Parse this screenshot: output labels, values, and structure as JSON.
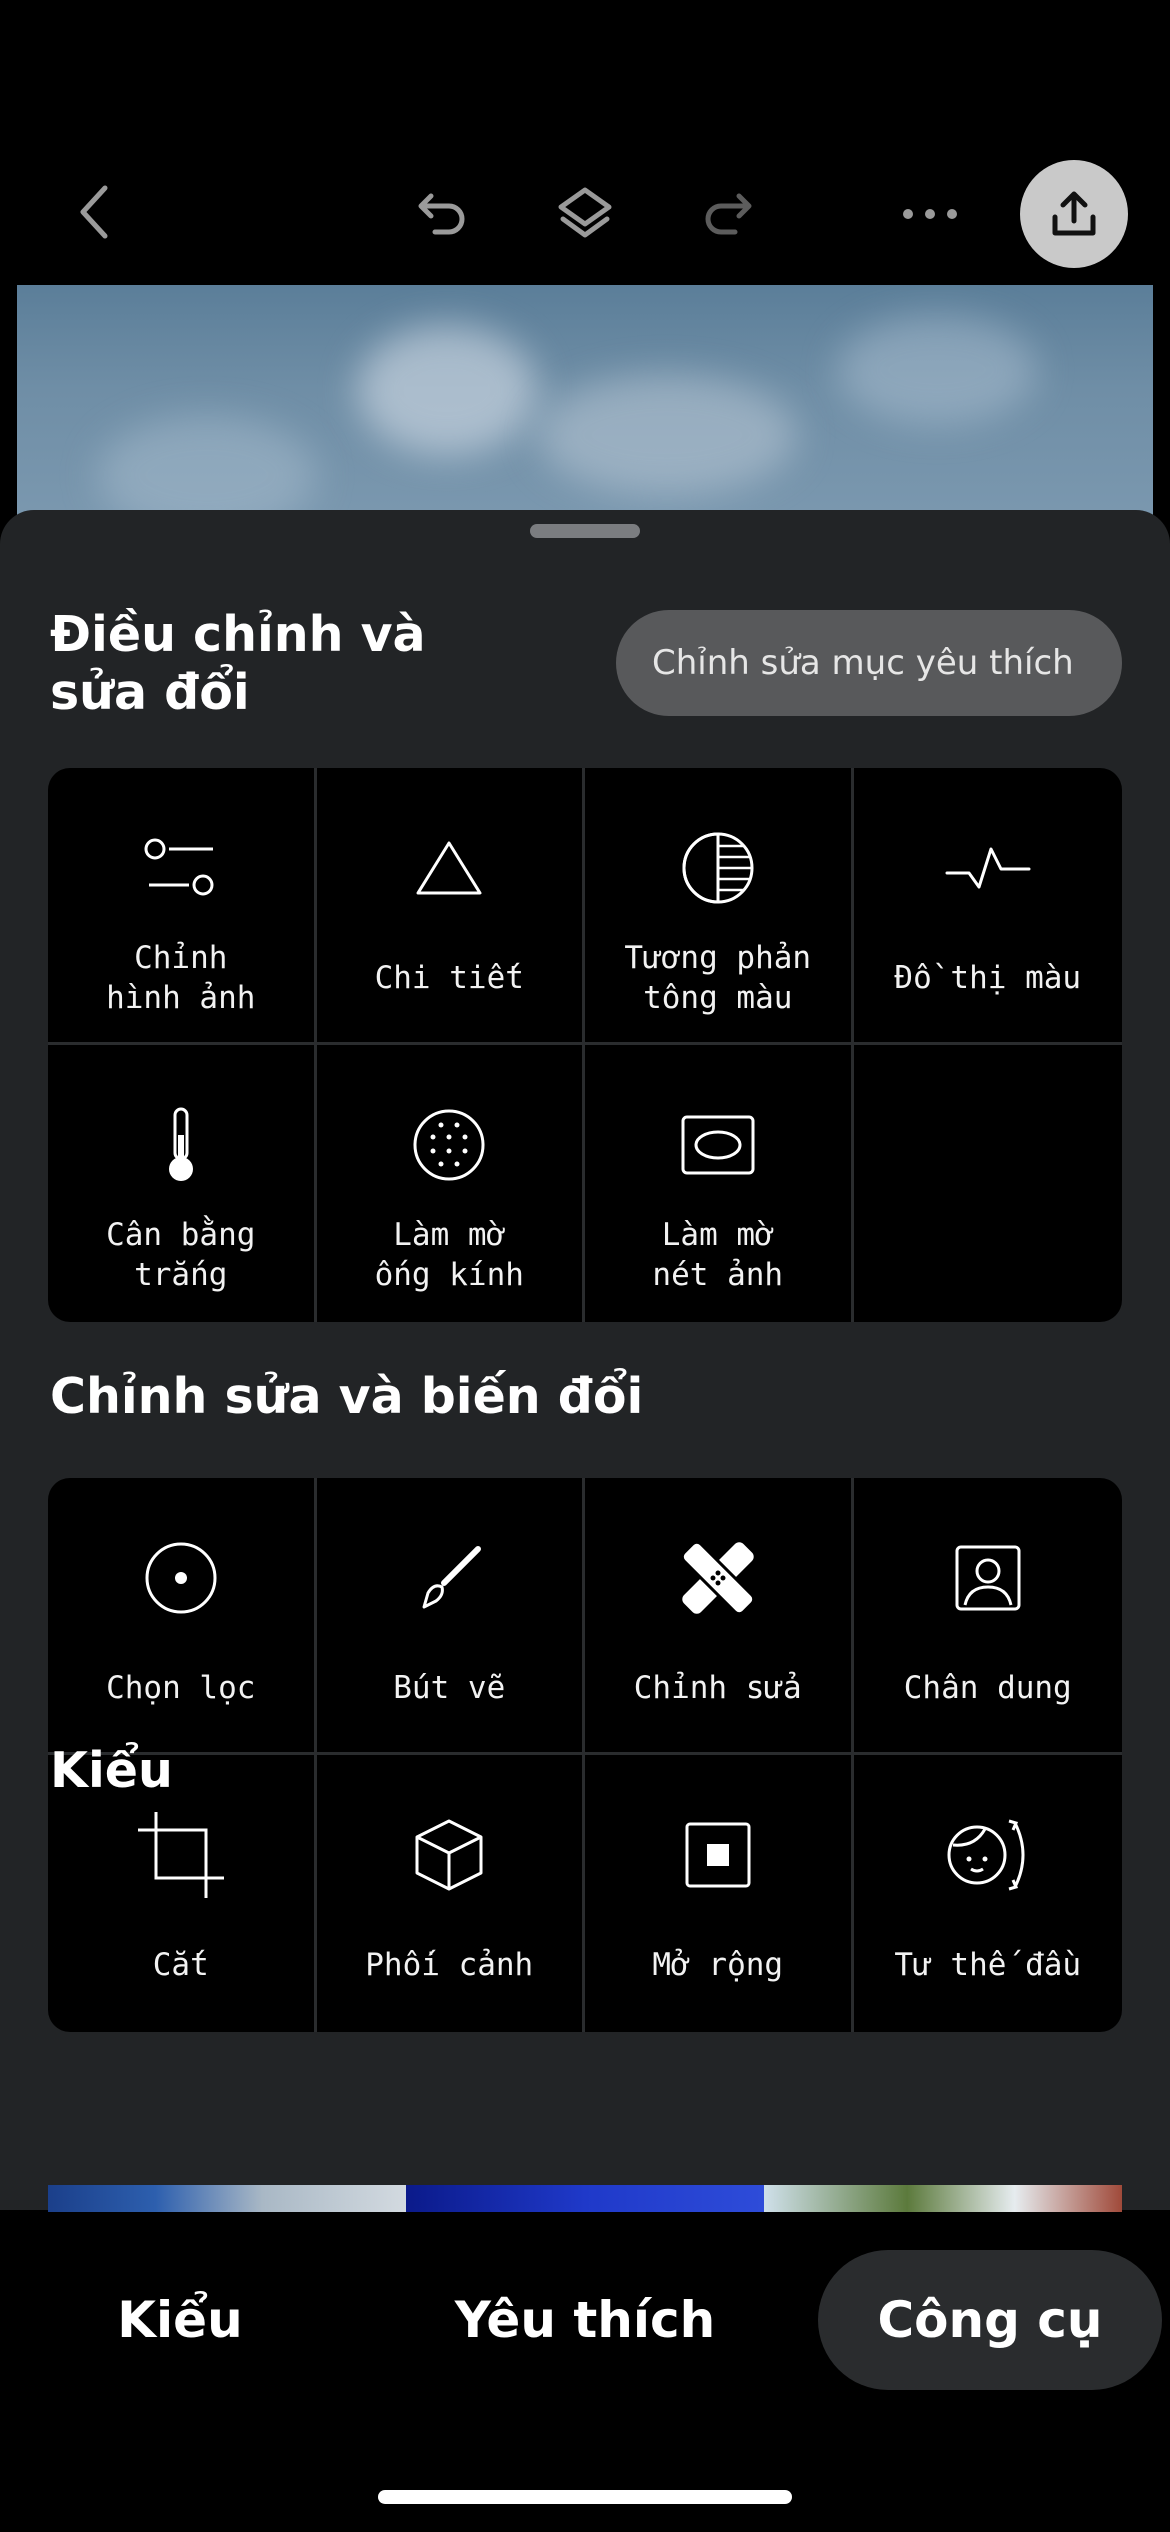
{
  "toolbar": {
    "icons": [
      "back-chevron-icon",
      "undo-icon",
      "layers-icon",
      "redo-icon",
      "more-icon",
      "share-icon"
    ]
  },
  "sheet": {
    "adjust": {
      "title_line1": "Điều chỉnh và",
      "title_line2": "sửa đổi",
      "search_placeholder": "Chỉnh sửa mục yêu thích",
      "tools": [
        {
          "label": "Chỉnh\nhình ảnh",
          "icon": "tune-icon"
        },
        {
          "label": "Chi tiết",
          "icon": "triangle-icon"
        },
        {
          "label": "Tương phản\ntông màu",
          "icon": "tonal-contrast-icon"
        },
        {
          "label": "Đồ thị màu",
          "icon": "curves-icon"
        },
        {
          "label": "Cân bằng\ntrắng",
          "icon": "thermometer-icon"
        },
        {
          "label": "Làm mờ\nống kính",
          "icon": "lens-blur-icon"
        },
        {
          "label": "Làm mờ\nnét ảnh",
          "icon": "vignette-icon"
        }
      ]
    },
    "edit": {
      "title": "Chỉnh sửa và biến đổi",
      "tools": [
        {
          "label": "Chọn lọc",
          "icon": "selective-icon"
        },
        {
          "label": "Bút vẽ",
          "icon": "brush-icon"
        },
        {
          "label": "Chỉnh sửa",
          "icon": "healing-bandage-icon"
        },
        {
          "label": "Chân dung",
          "icon": "portrait-icon"
        },
        {
          "label": "Cắt",
          "icon": "crop-icon"
        },
        {
          "label": "Phối cảnh",
          "icon": "perspective-cube-icon"
        },
        {
          "label": "Mở rộng",
          "icon": "expand-icon"
        },
        {
          "label": "Tư thế đầu",
          "icon": "head-pose-icon"
        }
      ]
    },
    "styles": {
      "title": "Kiểu"
    }
  },
  "tabs": [
    {
      "label": "Kiểu",
      "active": false
    },
    {
      "label": "Yêu thích",
      "active": false
    },
    {
      "label": "Công cụ",
      "active": true
    }
  ]
}
